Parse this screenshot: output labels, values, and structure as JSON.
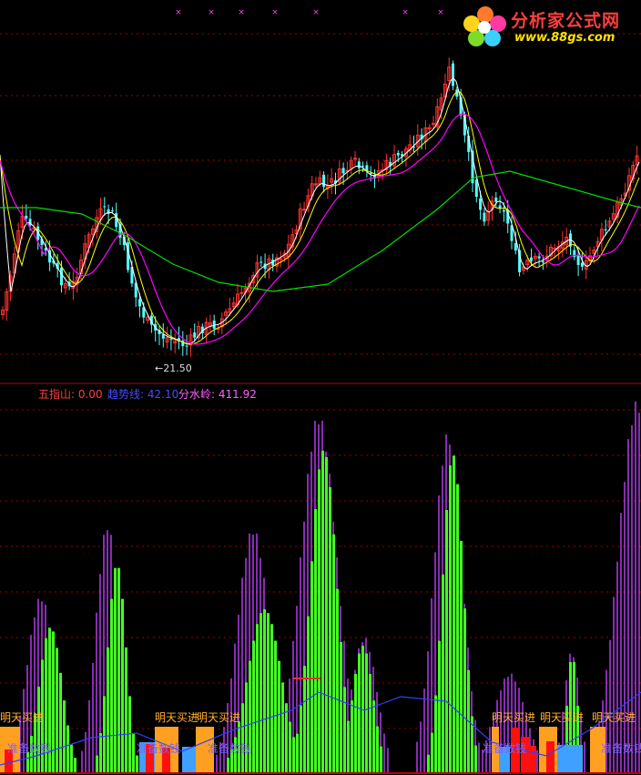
{
  "watermark": {
    "title": "分析家公式网",
    "url": "www.88gs.com"
  },
  "indicator_labels": {
    "wuzhishan": "五指山: 0.00",
    "qushixian": "趋势线: 42.10",
    "fenshuiling": "分水岭: 411.92"
  },
  "price_annotation": "←21.50",
  "signals": {
    "buy_tomorrow": "明天买进",
    "prepare": "准备数钱"
  },
  "colors": {
    "up_candle": "#ff3232",
    "down_candle": "#54ffff",
    "ma_short": "#ffffff",
    "ma_mid": "#ffff00",
    "ma_magenta": "#ff00ff",
    "ma_long": "#00e000",
    "bar_green": "#44ff22",
    "bar_magenta": "#c040ff",
    "trend_line": "#3040ff",
    "signal_text": "#ffb030",
    "signal_text2": "#8060ff",
    "grid": "#a00000"
  },
  "chart_data": [
    {
      "type": "candlestick",
      "price_low_annotated": 21.5,
      "overlays": [
        "white MA",
        "yellow MA",
        "magenta MA",
        "green MA"
      ],
      "grid": true
    },
    {
      "type": "bar",
      "series": [
        {
          "name": "五指山",
          "last": 0.0
        },
        {
          "name": "趋势线",
          "last": 42.1
        },
        {
          "name": "分水岭",
          "last": 411.92
        }
      ],
      "grid": true
    }
  ]
}
